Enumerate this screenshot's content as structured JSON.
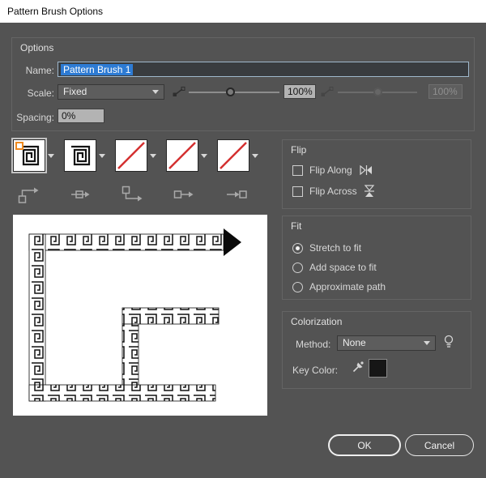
{
  "window": {
    "title": "Pattern Brush Options"
  },
  "options": {
    "group_label": "Options",
    "name_label": "Name:",
    "name_value": "Pattern Brush 1",
    "scale_label": "Scale:",
    "scale_dropdown_value": "Fixed",
    "scale_value": "100%",
    "scale_variation_value": "100%",
    "spacing_label": "Spacing:",
    "spacing_value": "0%"
  },
  "tiles": {
    "items": [
      {
        "name": "outer-corner-tile",
        "state": "pattern",
        "selected": true
      },
      {
        "name": "side-tile",
        "state": "pattern",
        "selected": false
      },
      {
        "name": "inner-corner-tile",
        "state": "none",
        "selected": false
      },
      {
        "name": "start-tile",
        "state": "none",
        "selected": false
      },
      {
        "name": "end-tile",
        "state": "none",
        "selected": false
      }
    ]
  },
  "flip": {
    "group_label": "Flip",
    "along_label": "Flip Along",
    "across_label": "Flip Across",
    "along_checked": false,
    "across_checked": false
  },
  "fit": {
    "group_label": "Fit",
    "options": [
      {
        "label": "Stretch to fit",
        "selected": true
      },
      {
        "label": "Add space to fit",
        "selected": false
      },
      {
        "label": "Approximate path",
        "selected": false
      }
    ]
  },
  "colorization": {
    "group_label": "Colorization",
    "method_label": "Method:",
    "method_value": "None",
    "key_color_label": "Key Color:",
    "key_color": "#161616"
  },
  "buttons": {
    "ok": "OK",
    "cancel": "Cancel"
  },
  "colors": {
    "selection": "#2d7bd4",
    "tile_none_slash": "#d43030",
    "corner_marker": "#ef8a1f",
    "dialog_background": "#535353"
  }
}
